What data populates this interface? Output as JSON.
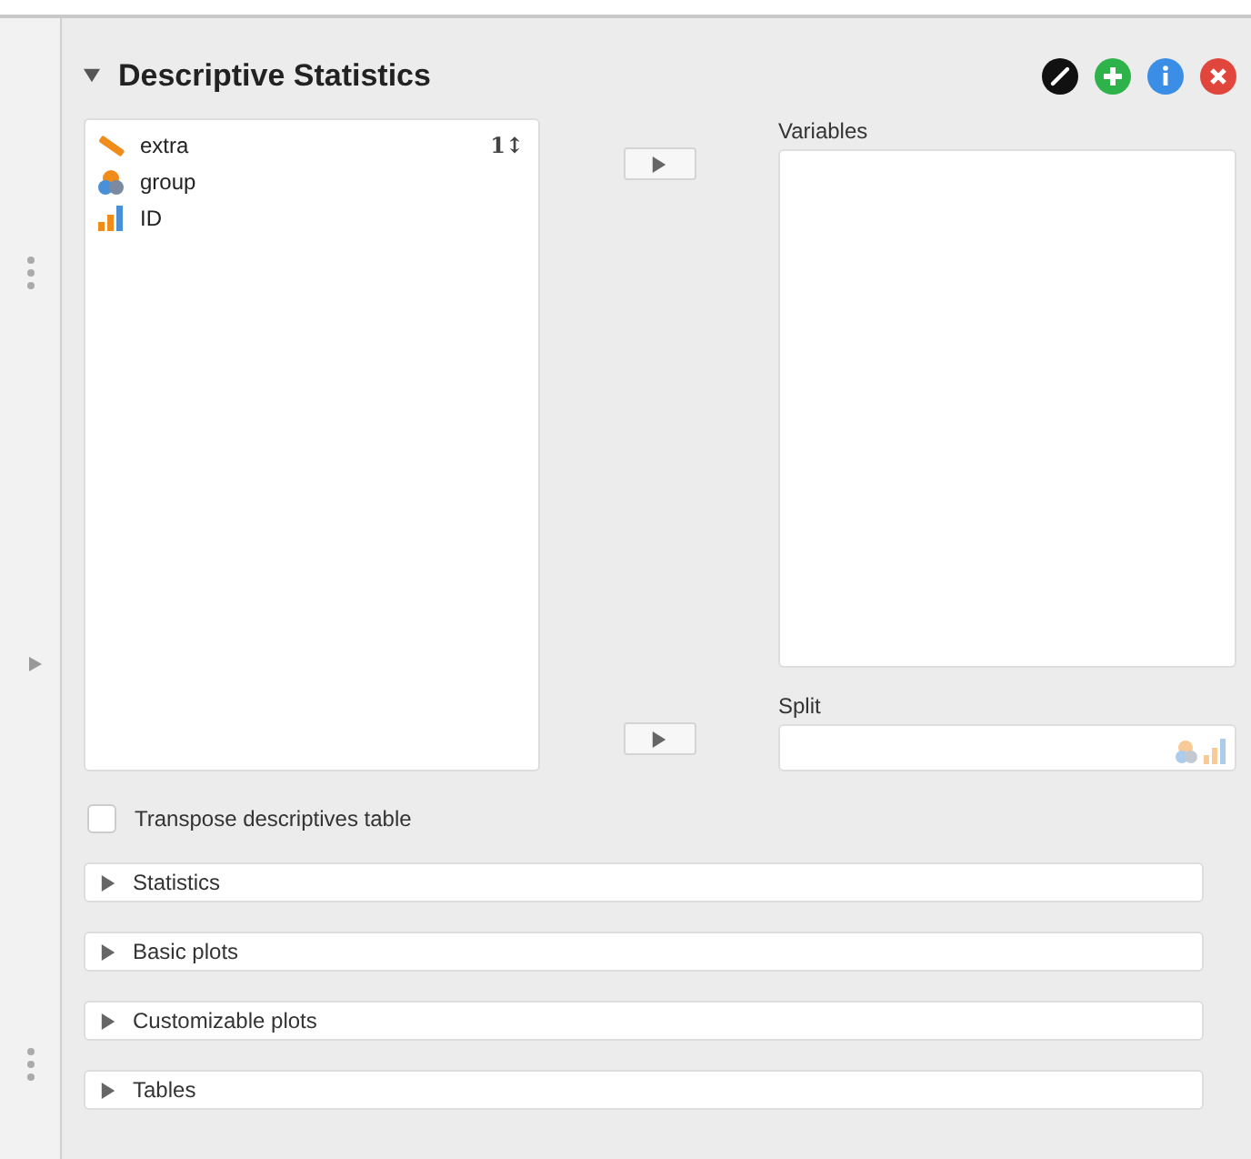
{
  "analysis": {
    "title": "Descriptive Statistics",
    "expanded": true
  },
  "available_variables": [
    {
      "name": "extra",
      "kind": "scale"
    },
    {
      "name": "group",
      "kind": "nominal"
    },
    {
      "name": "ID",
      "kind": "ordinal"
    }
  ],
  "sort_button": {
    "label": "1↕"
  },
  "target_lists": [
    {
      "label": "Variables",
      "kind": "tall"
    },
    {
      "label": "Split",
      "kind": "short"
    }
  ],
  "transpose_checkbox": {
    "label": "Transpose descriptives table",
    "checked": false
  },
  "sections": [
    {
      "label": "Statistics",
      "expanded": false
    },
    {
      "label": "Basic plots",
      "expanded": false
    },
    {
      "label": "Customizable plots",
      "expanded": false
    },
    {
      "label": "Tables",
      "expanded": false
    }
  ]
}
